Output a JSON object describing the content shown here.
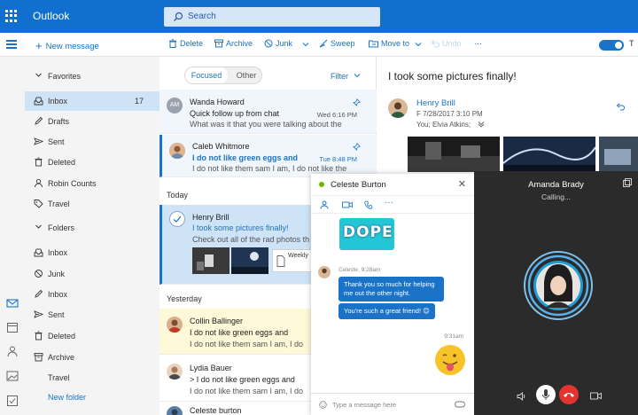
{
  "app": {
    "title": "Outlook"
  },
  "search": {
    "placeholder": "Search"
  },
  "toolbar": {
    "new_message": "New message",
    "delete": "Delete",
    "archive": "Archive",
    "junk": "Junk",
    "sweep": "Sweep",
    "move_to": "Move to",
    "undo": "Undo",
    "more": "···",
    "toggle_label": "T"
  },
  "nav": {
    "favorites": "Favorites",
    "favorites_items": [
      {
        "label": "Inbox",
        "count": "17",
        "icon": "inbox-icon"
      },
      {
        "label": "Drafts",
        "icon": "pencil-icon"
      },
      {
        "label": "Sent",
        "icon": "send-icon"
      },
      {
        "label": "Deleted",
        "icon": "trash-icon"
      },
      {
        "label": "Robin Counts",
        "icon": "person-icon"
      },
      {
        "label": "Travel",
        "icon": "tag-icon"
      }
    ],
    "folders": "Folders",
    "folder_items": [
      {
        "label": "Inbox",
        "icon": "inbox-icon"
      },
      {
        "label": "Junk",
        "icon": "block-icon"
      },
      {
        "label": "Inbox",
        "icon": "pencil-icon"
      },
      {
        "label": "Sent",
        "icon": "send-icon"
      },
      {
        "label": "Deleted",
        "icon": "trash-icon"
      },
      {
        "label": "Archive",
        "icon": "archive-icon"
      },
      {
        "label": "Travel",
        "icon": ""
      }
    ],
    "new_folder": "New folder"
  },
  "list": {
    "focused": "Focused",
    "other": "Other",
    "filter": "Filter",
    "today": "Today",
    "yesterday": "Yesterday",
    "messages": [
      {
        "initials": "AM",
        "from": "Wanda Howard",
        "subject": "Quick follow up from chat",
        "date": "Wed 6:16 PM",
        "preview": "What was it that you were talking about the"
      },
      {
        "from": "Caleb Whitmore",
        "subject": "I do not like green eggs and",
        "date": "Tue 8:48 PM",
        "preview": "I do not like them sam I am, I do not like the"
      },
      {
        "from": "Henry Brill",
        "subject": "I took some pictures finally!",
        "preview": "Check out all of the rad photos th",
        "attachment": "Weekly"
      },
      {
        "from": "Collin Ballinger",
        "subject": "I do not like green eggs and",
        "preview": "I do not like them sam I am, I do"
      },
      {
        "from": "Lydia Bauer",
        "subject": "> I do not like green eggs and",
        "preview": "I do not like them sam I am, I do"
      },
      {
        "from": "Celeste burton"
      }
    ]
  },
  "reading": {
    "subject": "I took some pictures finally!",
    "from": "Henry Brill",
    "date": "F 7/28/2017 3:10 PM",
    "to": "You; Elvia Atkins;"
  },
  "chat": {
    "name": "Celeste Burton",
    "sticker": "DOPE",
    "sender_meta": "Celeste, 9:28am",
    "bubble1": "Thank you so much for helping me out the other night.",
    "bubble2": "You're such a great friend! 😊",
    "time": "9:31am",
    "placeholder": "Type a message here",
    "close": "✕"
  },
  "call": {
    "name": "Amanda Brady",
    "status": "Calling..."
  },
  "colors": {
    "brand": "#1170cf",
    "accent": "#1a73c6",
    "selected": "#cfe3f7",
    "presence": "#6bb700",
    "hangup": "#e3342f"
  }
}
